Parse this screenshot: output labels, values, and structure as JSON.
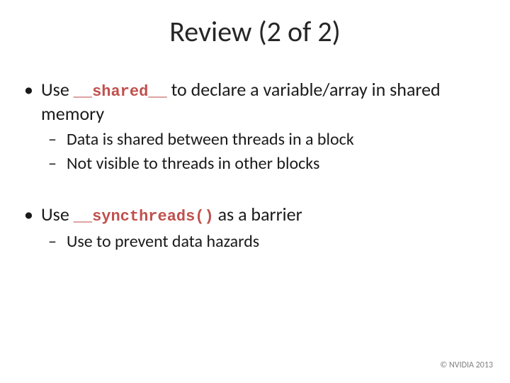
{
  "title": "Review (2 of 2)",
  "bullets": [
    {
      "prefix": "Use ",
      "code": "__shared__",
      "suffix": " to declare a variable/array in shared memory",
      "sub": [
        "Data is shared between threads in a block",
        "Not visible to threads in other blocks"
      ]
    },
    {
      "prefix": "Use ",
      "code": "__syncthreads()",
      "suffix": " as a barrier",
      "sub": [
        "Use to prevent data hazards"
      ]
    }
  ],
  "footer": "© NVIDIA 2013"
}
